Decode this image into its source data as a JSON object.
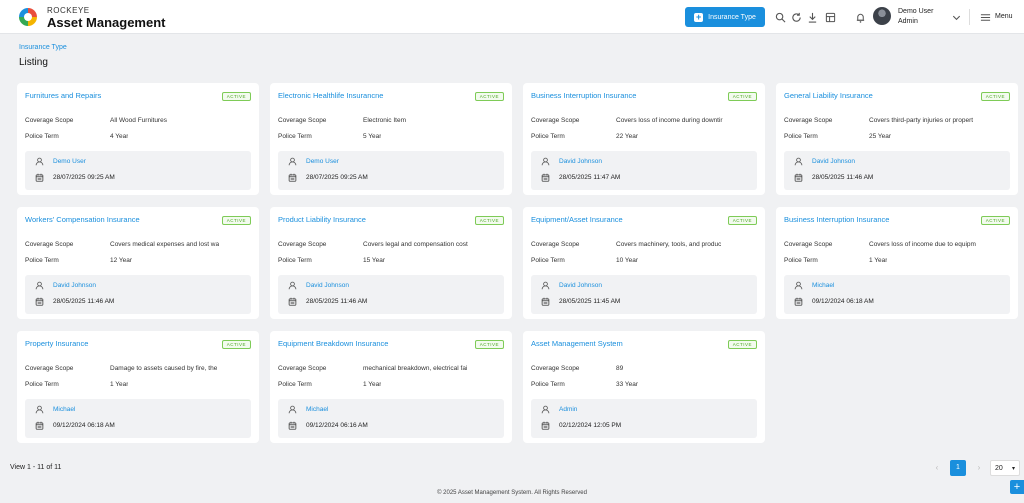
{
  "brand": {
    "top": "ROCKEYE",
    "main": "Asset Management"
  },
  "header": {
    "add_button_label": "Insurance Type",
    "user_name": "Demo User",
    "user_role": "Admin",
    "menu_label": "Menu"
  },
  "breadcrumb": "Insurance Type",
  "page_title": "Listing",
  "labels": {
    "scope": "Coverage Scope",
    "term": "Police Term",
    "badge": "ACTIVE"
  },
  "cards": [
    {
      "title": "Furnitures and Repairs",
      "scope": "All Wood Furnitures",
      "term": "4 Year",
      "user": "Demo User",
      "date": "28/07/2025 09:25 AM"
    },
    {
      "title": "Electronic Healthlife Insurancne",
      "scope": "Electronic Item",
      "term": "5 Year",
      "user": "Demo User",
      "date": "28/07/2025 09:25 AM"
    },
    {
      "title": "Business Interruption Insurance",
      "scope": "Covers loss of income during downtir",
      "term": "22 Year",
      "user": "David Johnson",
      "date": "28/05/2025 11:47 AM"
    },
    {
      "title": "General Liability Insurance",
      "scope": "Covers third-party injuries or propert",
      "term": "25 Year",
      "user": "David Johnson",
      "date": "28/05/2025 11:46 AM"
    },
    {
      "title": "Workers' Compensation Insurance",
      "scope": "Covers medical expenses and lost wa",
      "term": "12 Year",
      "user": "David Johnson",
      "date": "28/05/2025 11:46 AM"
    },
    {
      "title": "Product Liability Insurance",
      "scope": "Covers legal and compensation cost",
      "term": "15 Year",
      "user": "David Johnson",
      "date": "28/05/2025 11:46 AM"
    },
    {
      "title": "Equipment/Asset Insurance",
      "scope": "Covers machinery, tools, and produc",
      "term": "10 Year",
      "user": "David Johnson",
      "date": "28/05/2025 11:45 AM"
    },
    {
      "title": "Business Interruption Insurance",
      "scope": "Covers loss of income due to equipm",
      "term": "1 Year",
      "user": "Michael",
      "date": "09/12/2024 06:18 AM"
    },
    {
      "title": "Property Insurance",
      "scope": "Damage to assets caused by fire, the",
      "term": "1 Year",
      "user": "Michael",
      "date": "09/12/2024 06:18 AM"
    },
    {
      "title": "Equipment Breakdown Insurance",
      "scope": "mechanical breakdown, electrical fai",
      "term": "1 Year",
      "user": "Michael",
      "date": "09/12/2024 06:16 AM"
    },
    {
      "title": "Asset Management System",
      "scope": "89",
      "term": "33 Year",
      "user": "Admin",
      "date": "02/12/2024 12:05 PM"
    }
  ],
  "pagination": {
    "view_count": "View 1 - 11 of 11",
    "current_page": "1",
    "page_size": "20"
  },
  "footer": "© 2025 Asset Management System. All Rights Reserved",
  "colors": {
    "accent": "#1a8fdd",
    "badge_green": "#4ea823"
  }
}
